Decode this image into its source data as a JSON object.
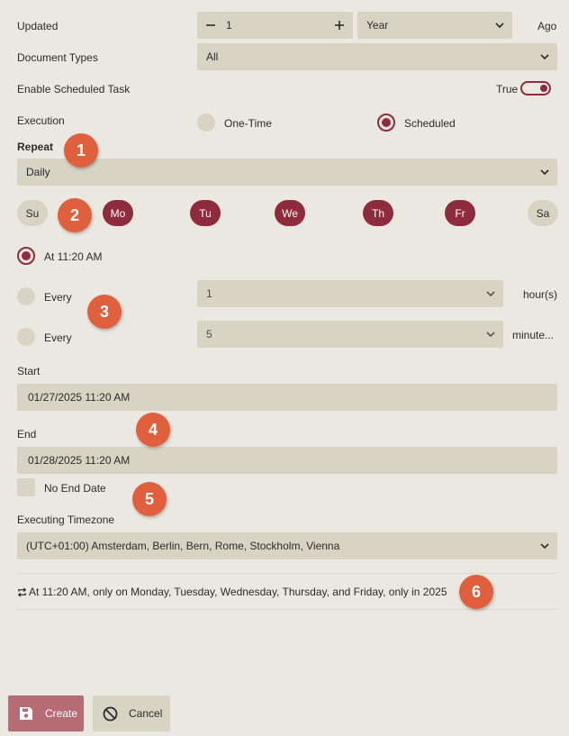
{
  "updated": {
    "label": "Updated",
    "value": "1",
    "unit": "Year",
    "suffix": "Ago"
  },
  "document_types": {
    "label": "Document Types",
    "value": "All"
  },
  "scheduled_task": {
    "label": "Enable Scheduled Task",
    "toggle_label": "True",
    "enabled": true
  },
  "execution": {
    "label": "Execution",
    "options": [
      "One-Time",
      "Scheduled"
    ],
    "selected": "Scheduled"
  },
  "repeat": {
    "label": "Repeat",
    "value": "Daily"
  },
  "days": [
    {
      "label": "Su",
      "selected": false
    },
    {
      "label": "Mo",
      "selected": true
    },
    {
      "label": "Tu",
      "selected": true
    },
    {
      "label": "We",
      "selected": true
    },
    {
      "label": "Th",
      "selected": true
    },
    {
      "label": "Fr",
      "selected": true
    },
    {
      "label": "Sa",
      "selected": false
    }
  ],
  "timing": {
    "at_label": "At 11:20 AM",
    "every_hours": {
      "label": "Every",
      "value": "1",
      "unit": "hour(s)"
    },
    "every_minutes": {
      "label": "Every",
      "value": "5",
      "unit": "minute..."
    }
  },
  "start": {
    "label": "Start",
    "value": "01/27/2025 11:20 AM"
  },
  "end": {
    "label": "End",
    "value": "01/28/2025 11:20 AM"
  },
  "no_end_date": {
    "label": "No End Date",
    "checked": false
  },
  "timezone": {
    "label": "Executing Timezone",
    "value": "(UTC+01:00) Amsterdam, Berlin, Bern, Rome, Stockholm, Vienna"
  },
  "summary": "At 11:20 AM, only on Monday, Tuesday, Wednesday, Thursday, and Friday, only in 2025",
  "badges": [
    "1",
    "2",
    "3",
    "4",
    "5",
    "6"
  ],
  "buttons": {
    "create": "Create",
    "cancel": "Cancel"
  },
  "colors": {
    "accent": "#8e2b3c",
    "badge": "#e0603e",
    "field": "#d8d4c4",
    "background": "#ebe8e1"
  }
}
